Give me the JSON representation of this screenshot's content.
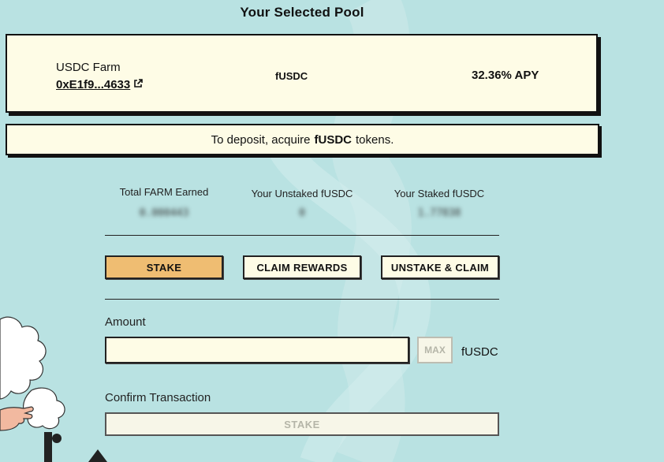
{
  "page": {
    "title": "Your Selected Pool"
  },
  "pool": {
    "name": "USDC Farm",
    "address": "0xE1f9...4633",
    "token": "fUSDC",
    "apy": "32.36% APY"
  },
  "deposit_banner": {
    "prefix": "To deposit, acquire",
    "token": "fUSDC",
    "suffix": "tokens."
  },
  "stats": {
    "total_farm_label": "Total FARM Earned",
    "total_farm_value": "0.000443",
    "unstaked_label": "Your Unstaked fUSDC",
    "unstaked_value": "0",
    "staked_label": "Your Staked fUSDC",
    "staked_value": "1.77838"
  },
  "actions": {
    "stake": "STAKE",
    "claim": "CLAIM REWARDS",
    "unstake": "UNSTAKE & CLAIM"
  },
  "amount": {
    "label": "Amount",
    "value": "",
    "placeholder": "",
    "max_label": "MAX",
    "unit": "fUSDC"
  },
  "confirm": {
    "label": "Confirm Transaction",
    "button": "STAKE"
  },
  "colors": {
    "background": "#b9e2e2",
    "card": "#fefce6",
    "active_button": "#efbd72"
  }
}
